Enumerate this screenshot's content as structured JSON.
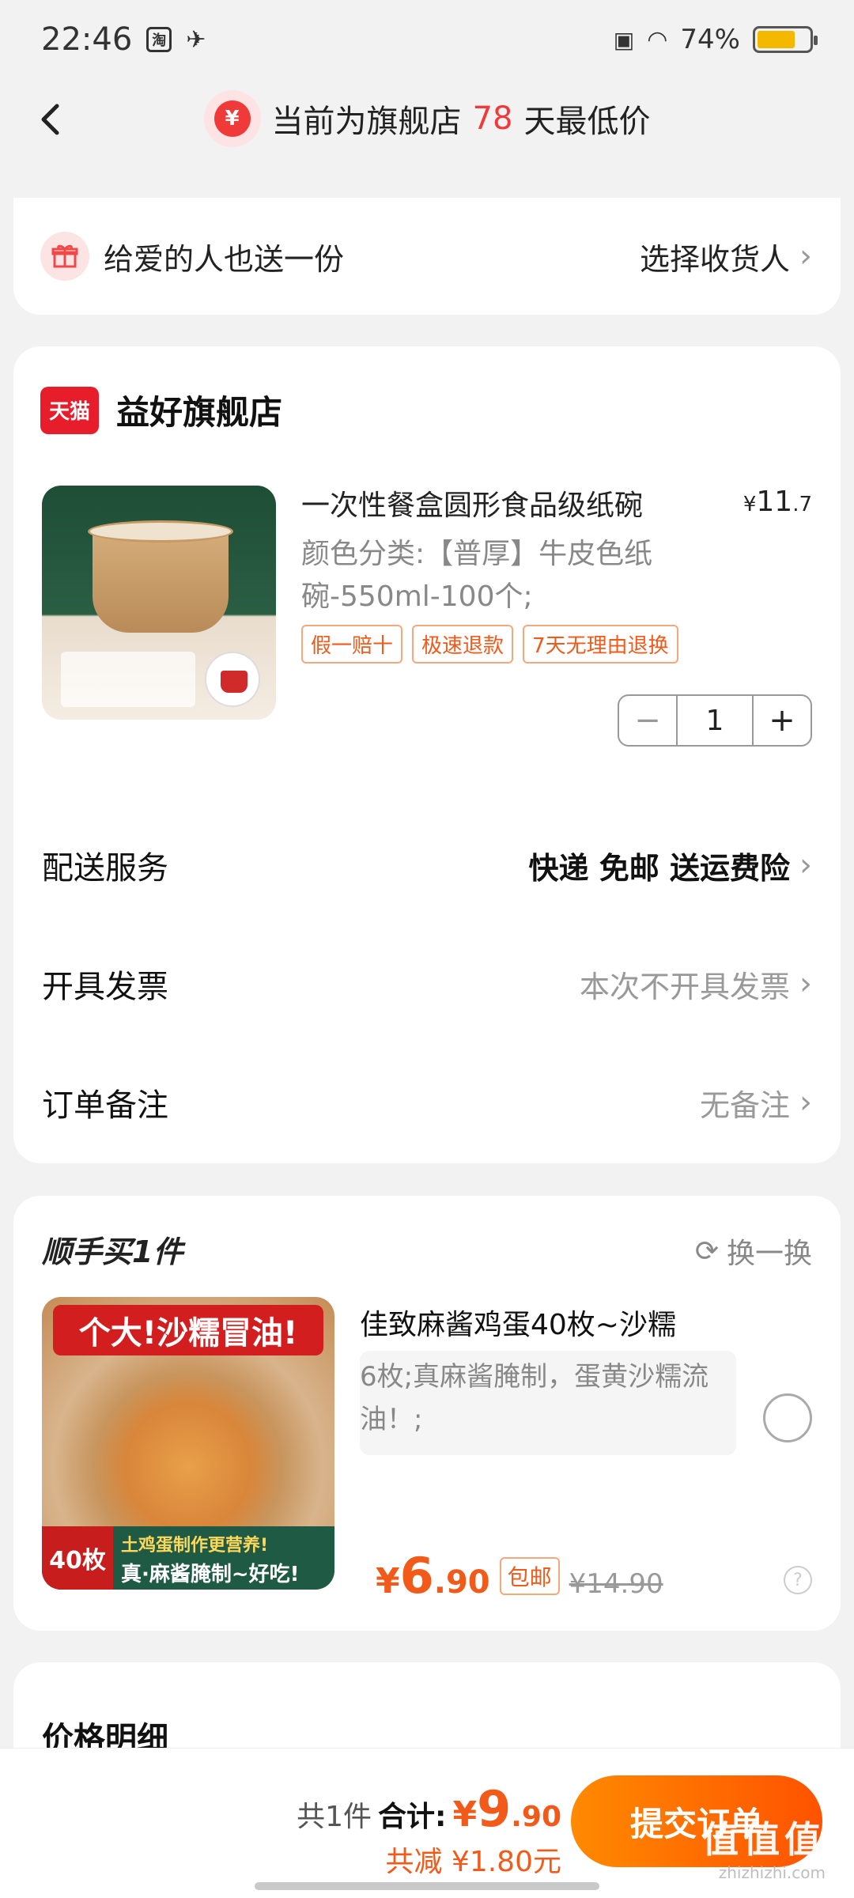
{
  "status_bar": {
    "time": "22:46",
    "app_badge": "淘",
    "battery_pct": "74%",
    "battery_level": 0.74
  },
  "nav": {
    "title_prefix": "当前为旗舰店",
    "days": "78",
    "title_suffix": "天最低价",
    "badge_symbol": "¥"
  },
  "gift": {
    "label": "给爱的人也送一份",
    "action": "选择收货人"
  },
  "store": {
    "logo_text": "天猫",
    "name": "益好旗舰店"
  },
  "product": {
    "title": "一次性餐盒圆形食品级纸碗",
    "price_currency": "¥",
    "price_int": "11",
    "price_dec": ".7",
    "spec": "颜色分类:【普厚】牛皮色纸碗-550ml-100个;",
    "tags": [
      "假一赔十",
      "极速退款",
      "7天无理由退换"
    ],
    "quantity": "1",
    "minus": "−",
    "plus": "+"
  },
  "rows": {
    "delivery_label": "配送服务",
    "delivery_value": "快递 免邮 送运费险",
    "invoice_label": "开具发票",
    "invoice_value": "本次不开具发票",
    "note_label": "订单备注",
    "note_value": "无备注"
  },
  "addon": {
    "title": "顺手买1件",
    "swap": "换一换",
    "banner": "个大!沙糯冒油!",
    "img_count": "40枚",
    "img_sub1": "土鸡蛋制作更营养!",
    "img_sub2": "真·麻酱腌制~好吃!",
    "name": "佳致麻酱鸡蛋40枚~沙糯",
    "desc": "6枚;真麻酱腌制，蛋黄沙糯流油！;",
    "price_currency": "¥",
    "price_int": "6",
    "price_dec": ".90",
    "free_shipping": "包邮",
    "orig_price": "¥14.90"
  },
  "detail": {
    "title": "价格明细"
  },
  "bottom": {
    "count_text": "共1件",
    "total_label": "合计:",
    "total_currency": "¥",
    "total_int": "9",
    "total_dec": ".90",
    "saving": "共减 ¥1.80元",
    "submit": "提交订单",
    "watermark_big": "值值值",
    "watermark_small": "zhizhizhi.com"
  },
  "colors": {
    "accent": "#f25a1a",
    "red": "#f03a3a",
    "tmall": "#e81d2c"
  }
}
